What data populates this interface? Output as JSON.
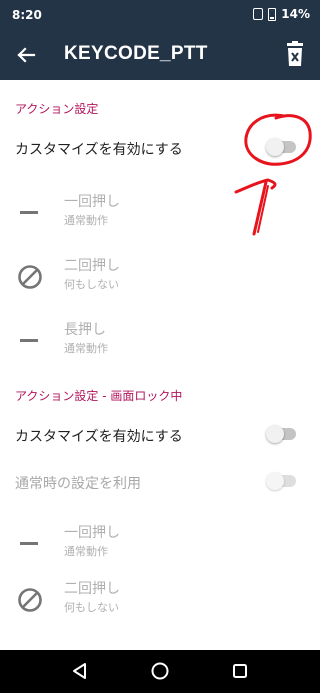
{
  "status_bar": {
    "time": "8:20",
    "battery": "14%"
  },
  "app_bar": {
    "title": "KEYCODE_PTT"
  },
  "section1": {
    "header": "アクション設定",
    "customize_label": "カスタマイズを有効にする",
    "customize_enabled": false,
    "actions": [
      {
        "title": "一回押し",
        "subtitle": "通常動作",
        "icon": "minus-icon"
      },
      {
        "title": "二回押し",
        "subtitle": "何もしない",
        "icon": "block-icon"
      },
      {
        "title": "長押し",
        "subtitle": "通常動作",
        "icon": "minus-icon"
      }
    ]
  },
  "section2": {
    "header": "アクション設定 - 画面ロック中",
    "customize_label": "カスタマイズを有効にする",
    "customize_enabled": false,
    "use_normal_label": "通常時の設定を利用",
    "use_normal_enabled": false,
    "actions": [
      {
        "title": "一回押し",
        "subtitle": "通常動作",
        "icon": "minus-icon"
      },
      {
        "title": "二回押し",
        "subtitle": "何もしない",
        "icon": "block-icon"
      }
    ]
  },
  "annotation_color": "#e8141d",
  "accent_color": "#b2155c"
}
